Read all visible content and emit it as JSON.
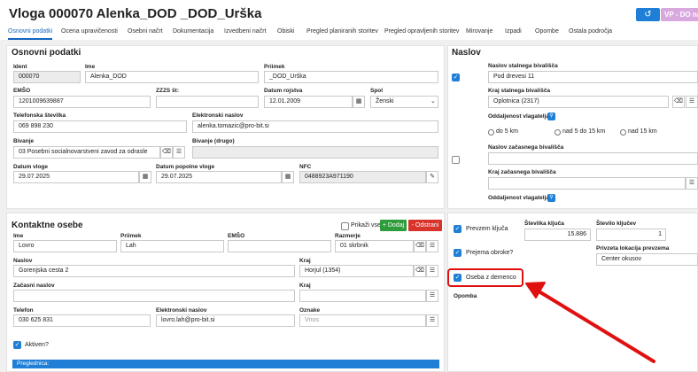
{
  "header": {
    "title": "Vloga 000070 Alenka_DOD _DOD_Urška",
    "undo_icon": "↺",
    "vp_label": "VP - DO na"
  },
  "tabs": [
    "Osnovni podatki",
    "Ocena upravičenosti",
    "Osebni načrt",
    "Dokumentacija",
    "Izvedbeni načrt",
    "Obiski",
    "Pregled planiranih storitev",
    "Pregled opravljenih storitev",
    "Mirovanje",
    "Izpadi",
    "Opombe",
    "Ostala področja"
  ],
  "basic": {
    "title": "Osnovni podatki",
    "ident_label": "Ident",
    "ident_value": "000070",
    "ime_label": "Ime",
    "ime_value": "Alenka_DOD",
    "priimek_label": "Priimek",
    "priimek_value": "_DOD_Urška",
    "emso_label": "EMŠO",
    "emso_value": "1201009639887",
    "zzzs_label": "ZZZS št:",
    "zzzs_value": "",
    "rojstvo_label": "Datum rojstva",
    "rojstvo_value": "12.01.2009",
    "spol_label": "Spol",
    "spol_value": "Ženski",
    "tel_label": "Telefonska številka",
    "tel_value": "069 898 230",
    "email_label": "Elektronski naslov",
    "email_value": "alenka.tomazic@pro-bit.si",
    "bivanje_label": "Bivanje",
    "bivanje_value": "03 Posebni socialnovarstveni zavod za odrasle",
    "bivanje2_label": "Bivanje (drugo)",
    "bivanje2_value": "",
    "vloge_label": "Datum vloge",
    "vloge_value": "29.07.2025",
    "popolne_label": "Datum popolne vloge",
    "popolne_value": "29.07.2025",
    "nfc_label": "NFC",
    "nfc_value": "0488923A971190"
  },
  "address": {
    "title": "Naslov",
    "stalni_label": "Naslov stalnega bivališča",
    "stalni_value": "Pod drevesi 11",
    "kraj_stalni_label": "Kraj stalnega bivališča",
    "kraj_stalni_value": "Oplotnica (2317)",
    "oddaljenost_label": "Oddaljenost vlagatelja",
    "radio_1": "do 5 km",
    "radio_2": "nad 5 do 15 km",
    "radio_3": "nad 15 km",
    "zacasni_label": "Naslov začasnega bivališča",
    "zacasni_value": "",
    "kraj_zacasni_label": "Kraj začasnega bivališča",
    "kraj_zacasni_value": "",
    "oddaljenost2_label": "Oddaljenost vlagatelja"
  },
  "contacts": {
    "title": "Kontaktne osebe",
    "show_all": "Prikaži vse",
    "add_label": "+ Dodaj",
    "remove_label": "- Odstrani",
    "ime_label": "Ime",
    "ime_value": "Lovro",
    "priimek_label": "Priimek",
    "priimek_value": "Lah",
    "emso_label": "EMŠO",
    "emso_value": "",
    "razmerje_label": "Razmerje",
    "razmerje_value": "01 skrbnik",
    "naslov_label": "Naslov",
    "naslov_value": "Gorenjska cesta 2",
    "kraj_label": "Kraj",
    "kraj_value": "Horjul (1354)",
    "zacasni_label": "Začasni naslov",
    "zacasni_value": "",
    "kraj2_label": "Kraj",
    "kraj2_value": "",
    "telefon_label": "Telefon",
    "telefon_value": "030 625 831",
    "email_label": "Elektronski naslov",
    "email_value": "lovro.lah@pro-bit.si",
    "oznake_label": "Oznake",
    "oznake_placeholder": "Vnos",
    "aktiven_label": "Aktiven?",
    "preglednica_label": "Preglednica:"
  },
  "keys": {
    "prevzem_label": "Prevzem ključa",
    "stevilka_label": "Številka ključa",
    "stevilka_value": "15.886",
    "stevilo_label": "Število ključev",
    "stevilo_value": "1",
    "obroke_label": "Prejema obroke?",
    "lokacija_label": "Privzeta lokacija prevzema",
    "lokacija_value": "Center okusov",
    "demenca_label": "Oseba z demenco",
    "opomba_label": "Opomba"
  },
  "colors": {
    "accent": "#1f7fd6",
    "add": "#2e9c3a",
    "remove": "#d9342b",
    "highlight": "#e01010",
    "vp": "#d9a8df"
  }
}
